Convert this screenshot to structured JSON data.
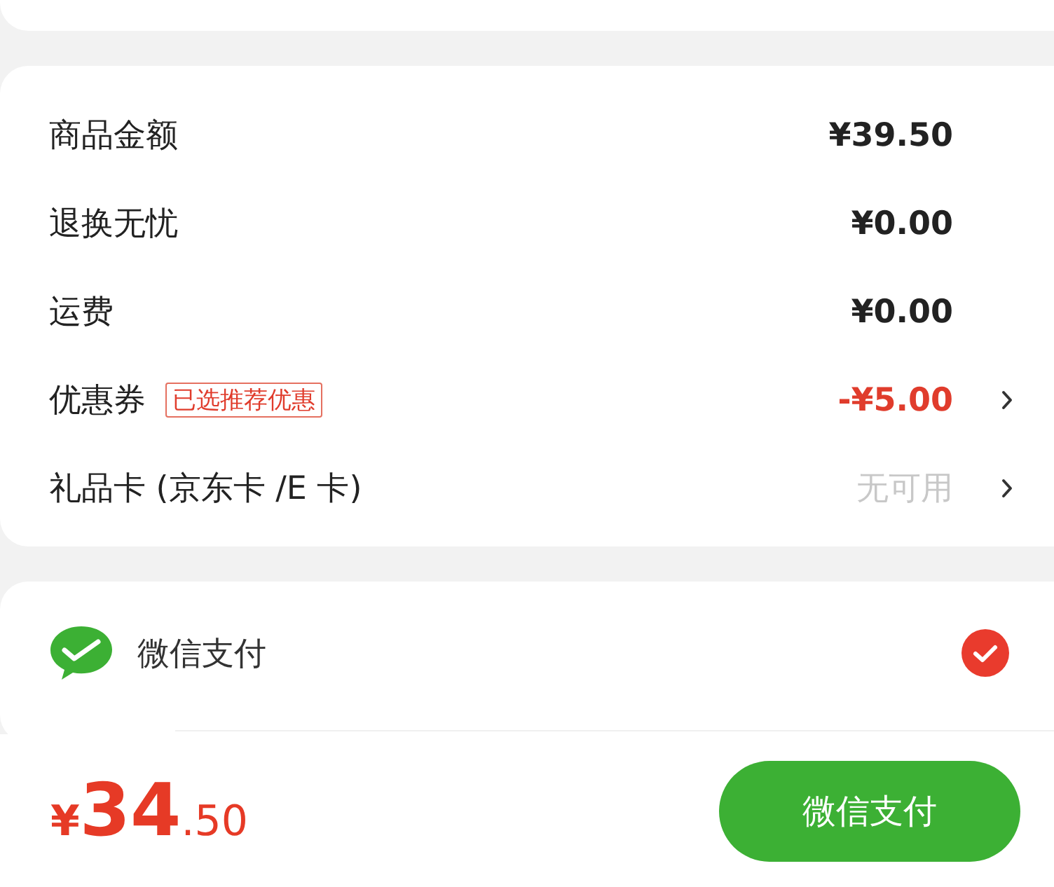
{
  "summary": [
    {
      "label": "商品金额",
      "value": "¥39.50",
      "kind": "normal",
      "arrow": false
    },
    {
      "label": "退换无忧",
      "value": "¥0.00",
      "kind": "normal",
      "arrow": false
    },
    {
      "label": "运费",
      "value": "¥0.00",
      "kind": "normal",
      "arrow": false
    },
    {
      "label": "优惠券",
      "tag": "已选推荐优惠",
      "value": "-¥5.00",
      "kind": "discount",
      "arrow": true
    },
    {
      "label": "礼品卡 (京东卡 /E 卡)",
      "value": "无可用",
      "kind": "unavailable",
      "arrow": true
    }
  ],
  "payment_methods": [
    {
      "label": "微信支付",
      "selected": true
    }
  ],
  "footer": {
    "currency": "¥",
    "price_integer": "34",
    "price_decimal": ".50",
    "pay_button": "微信支付"
  }
}
